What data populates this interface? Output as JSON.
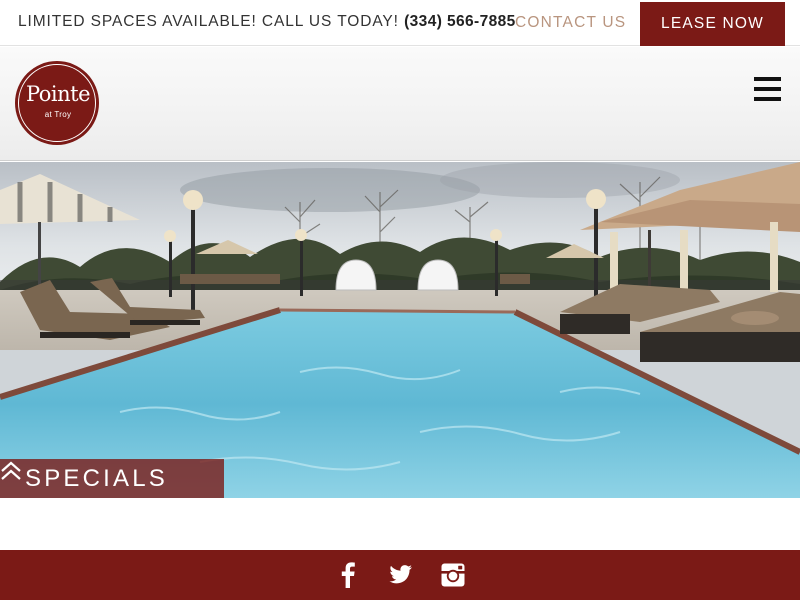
{
  "topbar": {
    "promo_text": "LIMITED SPACES AVAILABLE! CALL US TODAY!",
    "phone": "(334) 566-7885",
    "contact_label": "CONTACT US",
    "lease_label": "LEASE NOW"
  },
  "header": {
    "logo_word": "Pointe",
    "logo_sub": "at Troy",
    "menu_icon": "hamburger-icon"
  },
  "hero": {
    "image": "resort-style-pool-with-lounge-chairs-and-umbrellas",
    "specials_label": "SPECIALS",
    "specials_icon": "double-chevron-up-icon"
  },
  "footer": {
    "social_icons": [
      "facebook-icon",
      "twitter-icon",
      "instagram-icon"
    ]
  },
  "colors": {
    "brand": "#7b1a16",
    "contact": "#b9957f",
    "pool": "#5fb8d4"
  }
}
